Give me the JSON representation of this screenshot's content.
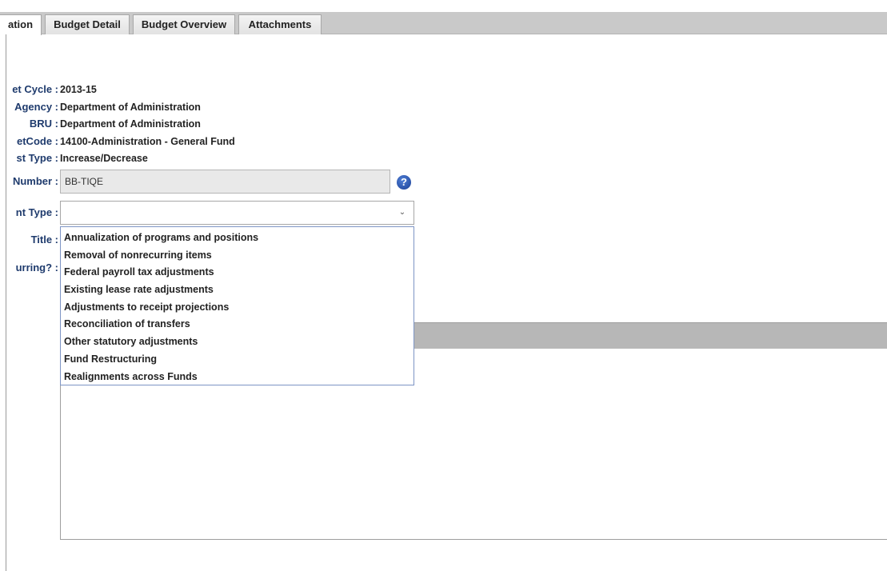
{
  "tabs": [
    {
      "label": "ation",
      "active": true
    },
    {
      "label": "Budget Detail",
      "active": false
    },
    {
      "label": "Budget Overview",
      "active": false
    },
    {
      "label": "Attachments",
      "active": false
    }
  ],
  "fields": {
    "cycle": {
      "label": "et Cycle :",
      "value": "2013-15"
    },
    "agency": {
      "label": "Agency :",
      "value": "Department of Administration"
    },
    "bru": {
      "label": "BRU :",
      "value": "Department of Administration"
    },
    "budget_code": {
      "label": "etCode :",
      "value": "14100-Administration - General Fund"
    },
    "request_type": {
      "label": "st Type :",
      "value": "Increase/Decrease"
    },
    "number": {
      "label": "Number :",
      "value": "BB-TIQE"
    },
    "adjustment_type": {
      "label": "nt Type :",
      "value": ""
    },
    "title": {
      "label": "Title :"
    },
    "recurring": {
      "label": "urring? :"
    }
  },
  "help_icon": "question-circle-icon",
  "dropdown_options": [
    "Annualization of programs and positions",
    "Removal of nonrecurring items",
    "Federal payroll tax adjustments",
    "Existing lease rate adjustments",
    "Adjustments to receipt projections",
    "Reconciliation of transfers",
    "Other statutory adjustments",
    "Fund Restructuring",
    "Realignments across Funds"
  ],
  "colors": {
    "label_text": "#1f3b6d",
    "help_icon": "#1b3f94",
    "tab_strip": "#c9c9c9"
  }
}
